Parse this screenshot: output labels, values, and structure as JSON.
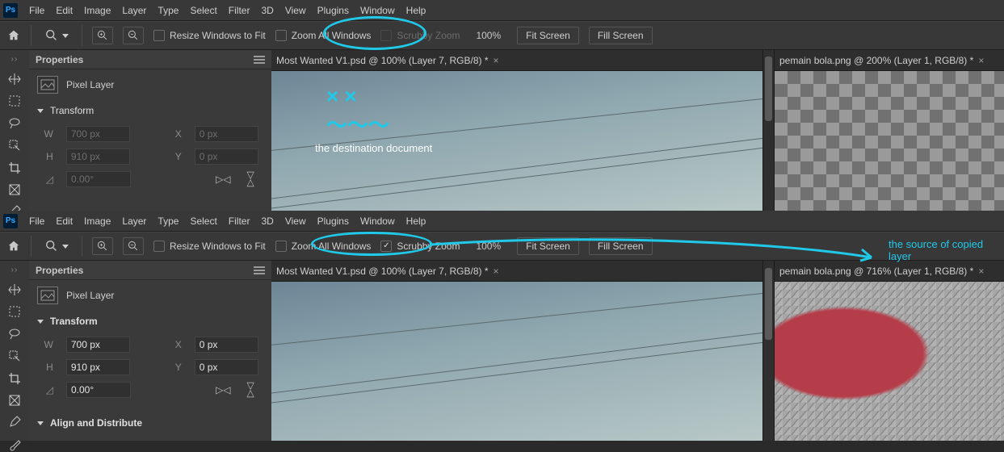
{
  "menu": [
    "File",
    "Edit",
    "Image",
    "Layer",
    "Type",
    "Select",
    "Filter",
    "3D",
    "View",
    "Plugins",
    "Window",
    "Help"
  ],
  "optionbar": {
    "resize_label": "Resize Windows to Fit",
    "zoomall_label": "Zoom All Windows",
    "scrubby_label": "Scrubby Zoom",
    "fit": "Fit Screen",
    "fill": "Fill Screen"
  },
  "panel": {
    "title": "Properties",
    "layer_type": "Pixel Layer",
    "transform_title": "Transform",
    "align_title": "Align and Distribute",
    "labels": {
      "W": "W",
      "H": "H",
      "X": "X",
      "Y": "Y",
      "angle": "0.00°"
    }
  },
  "top": {
    "zoom_percent": "100%",
    "scrubby_checked": false,
    "scrubby_disabled": true,
    "doc1_title": "Most Wanted V1.psd @ 100% (Layer 7, RGB/8) *",
    "doc2_title": "pemain bola.png @ 200% (Layer 1, RGB/8) *",
    "transform": {
      "W": "700 px",
      "H": "910 px",
      "X": "0 px",
      "Y": "0 px"
    },
    "ann_dest": "the destination document"
  },
  "bottom": {
    "zoom_percent": "100%",
    "scrubby_checked": true,
    "scrubby_disabled": false,
    "doc1_title": "Most Wanted V1.psd @ 100% (Layer 7, RGB/8) *",
    "doc2_title": "pemain bola.png @ 716% (Layer 1, RGB/8) *",
    "transform": {
      "W": "700 px",
      "H": "910 px",
      "X": "0 px",
      "Y": "0 px"
    },
    "ann_source": "the source of copied layer"
  }
}
